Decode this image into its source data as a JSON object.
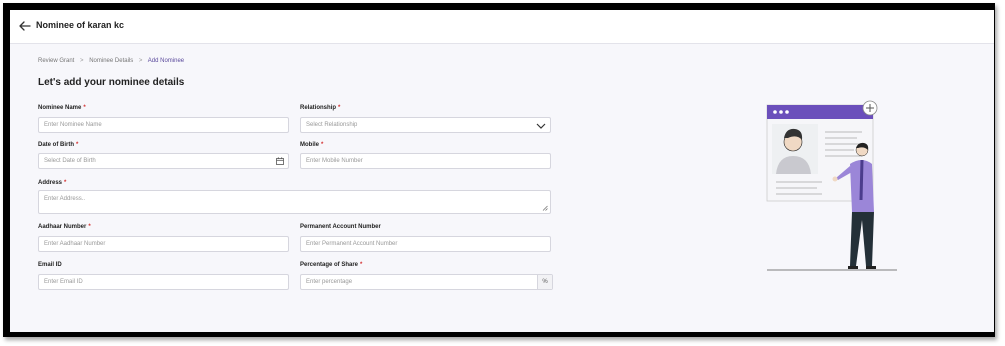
{
  "header": {
    "title": "Nominee of karan kc"
  },
  "breadcrumb": {
    "items": [
      "Review Grant",
      "Nominee Details",
      "Add Nominee"
    ],
    "separator": ">"
  },
  "page": {
    "heading": "Let's add your nominee details"
  },
  "form": {
    "nominee_name": {
      "label": "Nominee Name",
      "placeholder": "Enter Nominee Name"
    },
    "relationship": {
      "label": "Relationship",
      "placeholder": "Select Relationship"
    },
    "dob": {
      "label": "Date of Birth",
      "placeholder": "Select Date of Birth"
    },
    "mobile": {
      "label": "Mobile",
      "placeholder": "Enter Mobile Number"
    },
    "address": {
      "label": "Address",
      "placeholder": "Enter Address.."
    },
    "aadhaar": {
      "label": "Aadhaar Number",
      "placeholder": "Enter Aadhaar Number"
    },
    "pan": {
      "label": "Permanent Account Number",
      "placeholder": "Enter Permanent Account Number"
    },
    "email": {
      "label": "Email ID",
      "placeholder": "Enter Email ID"
    },
    "share": {
      "label": "Percentage of Share",
      "placeholder": "Enter percentage",
      "suffix": "%"
    },
    "required_mark": "*"
  },
  "colors": {
    "accent": "#6b4fbb",
    "required": "#d32f2f"
  },
  "icons": [
    "arrow-left-icon",
    "chevron-down-icon",
    "calendar-icon",
    "resize-handle-icon",
    "plus-icon"
  ]
}
